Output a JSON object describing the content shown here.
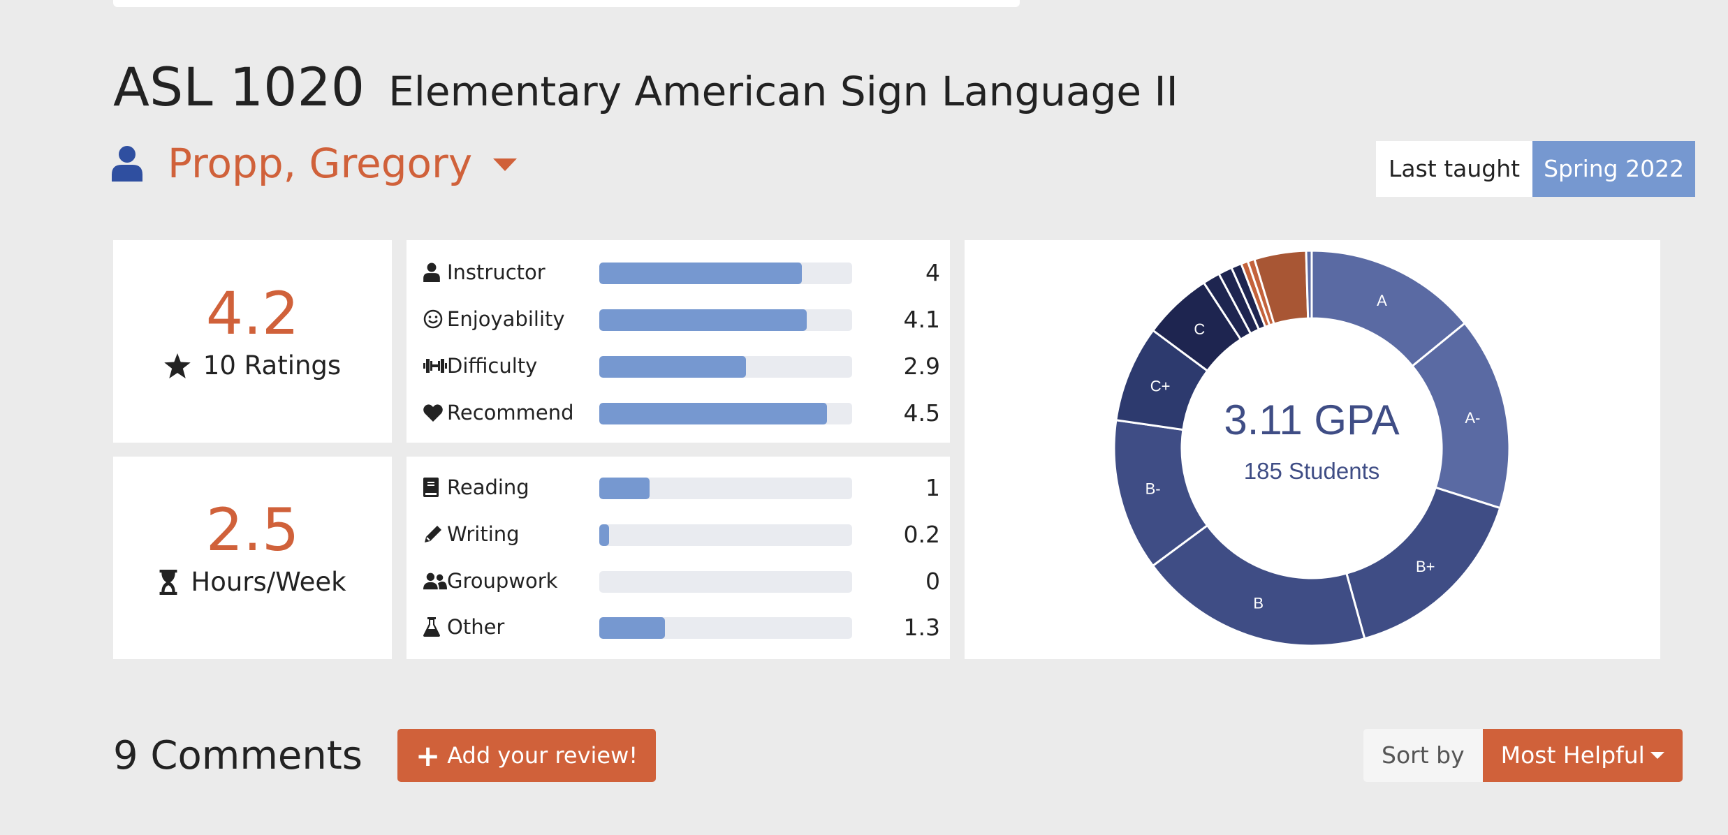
{
  "course": {
    "code": "ASL 1020",
    "name": "Elementary American Sign Language II"
  },
  "professor": {
    "name": "Propp, Gregory"
  },
  "last_taught": {
    "label": "Last taught",
    "value": "Spring 2022"
  },
  "rating": {
    "value": "4.2",
    "label": "10 Ratings"
  },
  "hours": {
    "value": "2.5",
    "label": "Hours/Week"
  },
  "metrics": [
    {
      "label": "Instructor",
      "value": "4",
      "fraction": 0.8,
      "icon": "user-icon"
    },
    {
      "label": "Enjoyability",
      "value": "4.1",
      "fraction": 0.82,
      "icon": "smile-icon"
    },
    {
      "label": "Difficulty",
      "value": "2.9",
      "fraction": 0.58,
      "icon": "dumbbell-icon"
    },
    {
      "label": "Recommend",
      "value": "4.5",
      "fraction": 0.9,
      "icon": "heart-icon"
    }
  ],
  "workload": [
    {
      "label": "Reading",
      "value": "1",
      "fraction": 0.2,
      "icon": "book-icon"
    },
    {
      "label": "Writing",
      "value": "0.2",
      "fraction": 0.04,
      "icon": "pencil-icon"
    },
    {
      "label": "Groupwork",
      "value": "0",
      "fraction": 0.0,
      "icon": "users-icon"
    },
    {
      "label": "Other",
      "value": "1.3",
      "fraction": 0.26,
      "icon": "flask-icon"
    }
  ],
  "chart_data": {
    "type": "pie",
    "center_value": "3.11 GPA",
    "center_label": "185 Students",
    "slices": [
      {
        "label": "A",
        "value": 25,
        "color": "#5a6aa3"
      },
      {
        "label": "A-",
        "value": 28,
        "color": "#5a6aa3"
      },
      {
        "label": "B+",
        "value": 28,
        "color": "#3f4d85"
      },
      {
        "label": "B",
        "value": 34,
        "color": "#3f4d85"
      },
      {
        "label": "B-",
        "value": 22,
        "color": "#3f4d85"
      },
      {
        "label": "C+",
        "value": 14,
        "color": "#2d3a6e"
      },
      {
        "label": "C",
        "value": 10,
        "color": "#1e2550"
      },
      {
        "label": "",
        "value": 2.5,
        "color": "#1e2550"
      },
      {
        "label": "",
        "value": 2,
        "color": "#1e2550"
      },
      {
        "label": "",
        "value": 1.5,
        "color": "#1e2550"
      },
      {
        "label": "",
        "value": 1,
        "color": "#c4623b"
      },
      {
        "label": "",
        "value": 1,
        "color": "#c4623b"
      },
      {
        "label": "",
        "value": 7.5,
        "color": "#a85634"
      },
      {
        "label": "",
        "value": 0.8,
        "color": "#5a6aa3"
      }
    ]
  },
  "comments": {
    "title": "9 Comments",
    "add_label": "Add your review!"
  },
  "sort": {
    "label": "Sort by",
    "value": "Most Helpful"
  }
}
